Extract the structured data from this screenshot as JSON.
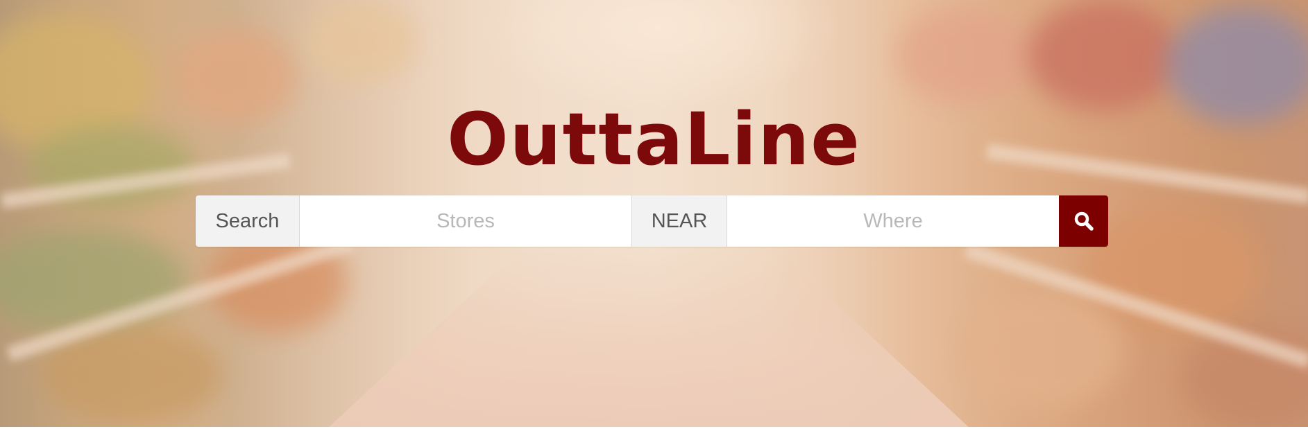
{
  "brand": {
    "logo_text": "OuttaLine",
    "logo_color": "#7d0a0a"
  },
  "search": {
    "search_label": "Search",
    "stores_placeholder": "Stores",
    "stores_value": "",
    "near_label": "NEAR",
    "where_placeholder": "Where",
    "where_value": "",
    "submit_icon": "search-icon",
    "submit_color": "#7d0000"
  },
  "background": {
    "description_icon": "supermarket-aisle-background"
  }
}
